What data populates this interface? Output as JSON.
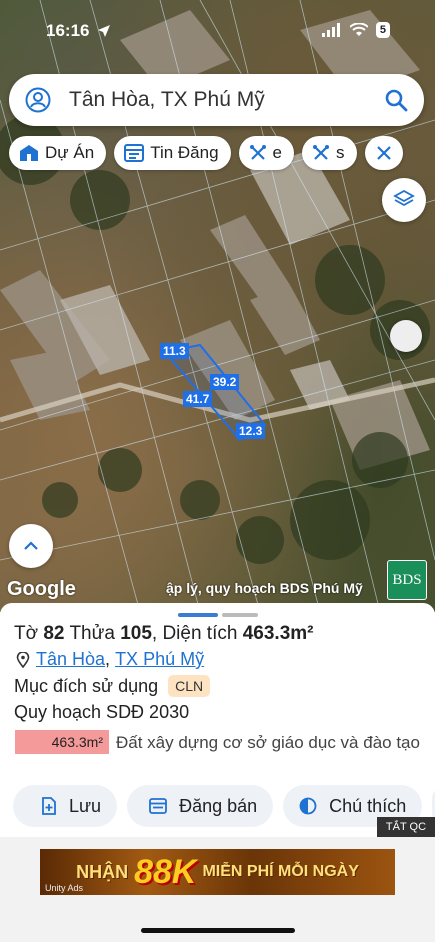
{
  "status": {
    "time": "16:16",
    "battery": "5"
  },
  "search": {
    "text": "Tân Hòa, TX Phú Mỹ"
  },
  "chips": [
    {
      "label": "Dự Án"
    },
    {
      "label": "Tin Đăng"
    },
    {
      "label": "e"
    },
    {
      "label": "s"
    }
  ],
  "plot": {
    "edges": [
      "11.3",
      "39.2",
      "41.7",
      "12.3"
    ]
  },
  "map": {
    "logo": "Google",
    "credit": "ập lý, quy hoạch BDS Phú Mỹ",
    "brand_badge": "BDS"
  },
  "parcel": {
    "sheet_label": "Tờ",
    "sheet_no": "82",
    "lot_label": "Thửa",
    "lot_no": "105",
    "area_label": "Diện tích",
    "area": "463.3m²",
    "ward": "Tân Hòa",
    "town": "TX Phú Mỹ",
    "purpose_label": "Mục đích sử dụng",
    "purpose_code": "CLN",
    "plan_label": "Quy hoạch SDĐ 2030",
    "plan_area": "463.3m²",
    "plan_desc": "Đất xây dựng cơ sở giáo dục và đào tạo"
  },
  "actions": {
    "save": "Lưu",
    "post": "Đăng bán",
    "legend": "Chú thích"
  },
  "ad": {
    "close": "TẮT QC",
    "t1": "NHẬN",
    "t2": "88K",
    "t3": "MIỄN PHÍ MỖI NGÀY",
    "sponsor": "Unity Ads"
  },
  "colors": {
    "accent": "#1f72d1",
    "plot_line": "#1e6fe8",
    "plan_fill": "#f59a9a",
    "badge_bg": "#fde3c2"
  }
}
